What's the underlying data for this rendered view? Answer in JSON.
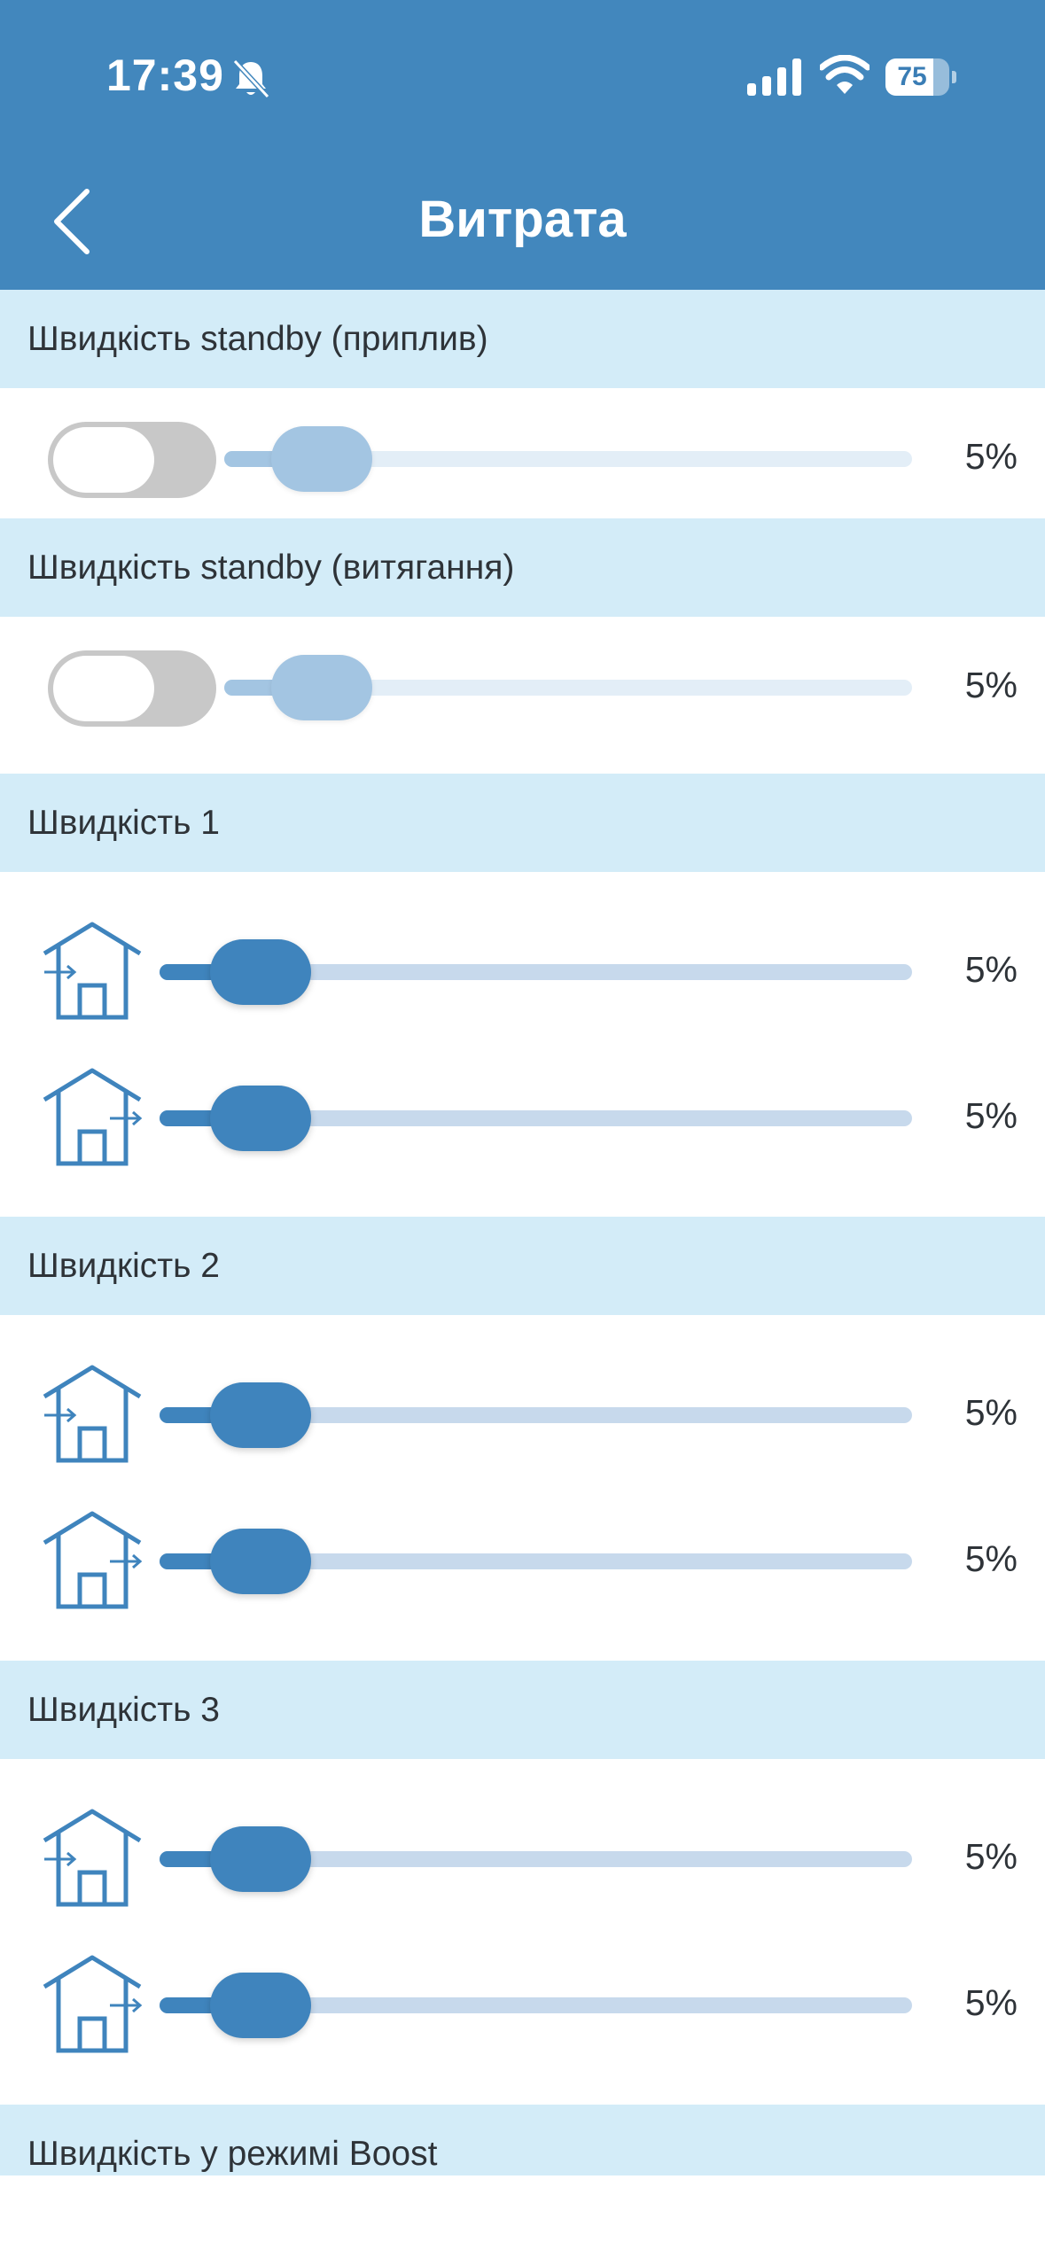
{
  "status_bar": {
    "time": "17:39",
    "battery": "75",
    "battery_level": 0.75,
    "icons": [
      "bell-slash-icon",
      "signal-icon",
      "wifi-icon",
      "battery-icon"
    ]
  },
  "nav": {
    "title": "Витрата",
    "back_icon": "chevron-left-icon"
  },
  "colors": {
    "header": "#4287bd",
    "section": "#d3ecf8",
    "accent": "#3f84bd",
    "accent_dim": "#a3c5e2"
  },
  "sections": [
    {
      "label": "Швидкість standby (приплив)",
      "toggle_on": false,
      "value_text": "5%",
      "value": 5
    },
    {
      "label": "Швидкість standby (витягання)",
      "toggle_on": false,
      "value_text": "5%",
      "value": 5
    },
    {
      "label": "Швидкість 1",
      "rows": [
        {
          "icon": "house-supply-icon",
          "value_text": "5%",
          "value": 5
        },
        {
          "icon": "house-exhaust-icon",
          "value_text": "5%",
          "value": 5
        }
      ]
    },
    {
      "label": "Швидкість 2",
      "rows": [
        {
          "icon": "house-supply-icon",
          "value_text": "5%",
          "value": 5
        },
        {
          "icon": "house-exhaust-icon",
          "value_text": "5%",
          "value": 5
        }
      ]
    },
    {
      "label": "Швидкість 3",
      "rows": [
        {
          "icon": "house-supply-icon",
          "value_text": "5%",
          "value": 5
        },
        {
          "icon": "house-exhaust-icon",
          "value_text": "5%",
          "value": 5
        }
      ]
    },
    {
      "label": "Швидкість у режимі Boost"
    }
  ]
}
